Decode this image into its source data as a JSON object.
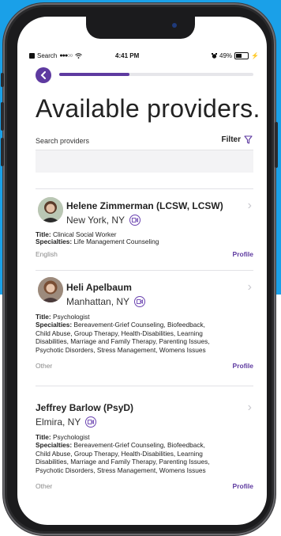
{
  "status_bar": {
    "carrier": "Search",
    "signal": "●●●○○",
    "wifi_icon": "wifi-icon",
    "time": "4:41 PM",
    "alarm_icon": "alarm-icon",
    "battery": "49%"
  },
  "progress": {
    "fraction": 0.36
  },
  "page": {
    "title": "Available providers."
  },
  "search": {
    "label": "Search providers",
    "filter_label": "Filter"
  },
  "colors": {
    "accent": "#5e3aa0",
    "background_blue": "#1aa0e8"
  },
  "providers": [
    {
      "name": "Helene Zimmerman (LCSW, LCSW)",
      "location": "New York, NY",
      "title_label": "Title:",
      "title": "Clinical Social Worker",
      "specialties_label": "Specialties:",
      "specialties": "Life Management Counseling",
      "language": "English",
      "profile_label": "Profile"
    },
    {
      "name": "Heli Apelbaum",
      "location": "Manhattan, NY",
      "title_label": "Title:",
      "title": "Psychologist",
      "specialties_label": "Specialties:",
      "specialties_lines": [
        "Bereavement-Grief Counseling, Biofeedback,",
        "Child Abuse, Group Therapy, Health-Disabilities, Learning",
        "Disabilities, Marriage and Family Therapy, Parenting Issues,",
        "Psychotic Disorders, Stress Management, Womens Issues"
      ],
      "language": "Other",
      "profile_label": "Profile"
    },
    {
      "name": "Jeffrey  Barlow (PsyD)",
      "location": "Elmira, NY",
      "title_label": "Title:",
      "title": "Psychologist",
      "specialties_label": "Specialties:",
      "specialties_lines": [
        "Bereavement-Grief Counseling, Biofeedback,",
        "Child Abuse, Group Therapy, Health-Disabilities, Learning",
        "Disabilities, Marriage and Family Therapy, Parenting Issues,",
        "Psychotic Disorders, Stress Management, Womens Issues"
      ],
      "language": "Other",
      "profile_label": "Profile"
    }
  ]
}
